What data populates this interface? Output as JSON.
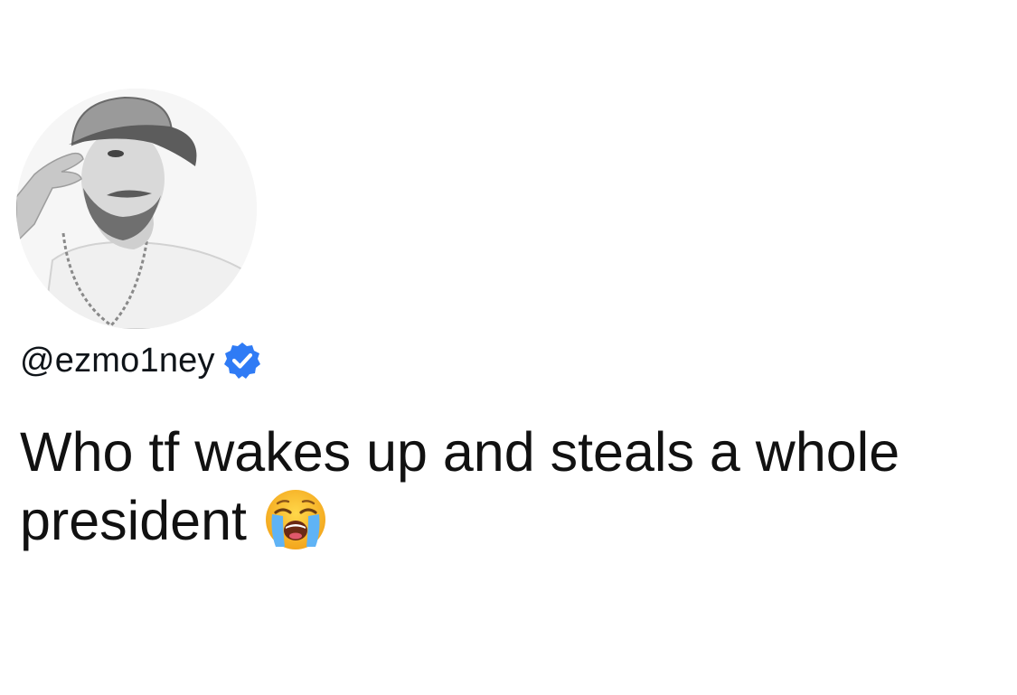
{
  "post": {
    "author": {
      "handle": "@ezmo1ney",
      "verified_badge": "verified-check-icon",
      "badge_color": "#2f7bf5"
    },
    "text_lines": [
      "Who tf wakes up and steals a whole",
      "president"
    ],
    "emoji": "loudly-crying-face"
  },
  "colors": {
    "background": "#ffffff",
    "text": "#111111",
    "verified": "#2f7bf5"
  }
}
